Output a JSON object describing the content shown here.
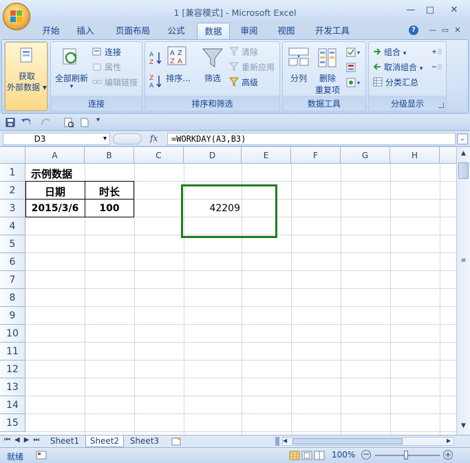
{
  "window": {
    "title": "1  [兼容模式] - Microsoft Excel",
    "min_glyph": "—",
    "max_glyph": "□",
    "close_glyph": "✕",
    "restore_glyph": "▭",
    "close_small_glyph": "✕"
  },
  "tabs": [
    "开始",
    "插入",
    "页面布局",
    "公式",
    "数据",
    "审阅",
    "视图",
    "开发工具"
  ],
  "active_tab": "数据",
  "ribbon": {
    "get_external": {
      "line1": "获取",
      "line2": "外部数据"
    },
    "connections": {
      "refresh_all": "全部刷新",
      "connections": "连接",
      "properties": "属性",
      "edit_links": "编辑链接",
      "label": "连接"
    },
    "sort_filter": {
      "sort": "排序...",
      "filter": "筛选",
      "clear": "清除",
      "reapply": "重新应用",
      "advanced": "高级",
      "label": "排序和筛选"
    },
    "data_tools": {
      "text_to_columns": "分列",
      "remove_dup_line1": "删除",
      "remove_dup_line2": "重复项",
      "label": "数据工具"
    },
    "outline": {
      "group": "组合",
      "ungroup": "取消组合",
      "subtotal": "分类汇总",
      "label": "分级显示"
    }
  },
  "formula_bar": {
    "name_box": "D3",
    "fx": "fx",
    "formula": "=WORKDAY(A3,B3)"
  },
  "columns": [
    "A",
    "B",
    "C",
    "D",
    "E",
    "F",
    "G",
    "H"
  ],
  "rows": [
    "1",
    "2",
    "3",
    "4",
    "5",
    "6",
    "7",
    "8",
    "9",
    "10",
    "11",
    "12",
    "13",
    "14",
    "15"
  ],
  "cells": {
    "A1": "示例数据",
    "A2": "日期",
    "B2": "时长",
    "A3": "2015/3/6",
    "B3": "100",
    "D3": "42209"
  },
  "sheets": [
    "Sheet1",
    "Sheet2",
    "Sheet3"
  ],
  "active_sheet": "Sheet2",
  "status": {
    "ready": "就绪",
    "zoom": "100%"
  },
  "colors": {
    "selection_border": "#1e7e1e",
    "ribbon_text": "#15428b"
  }
}
